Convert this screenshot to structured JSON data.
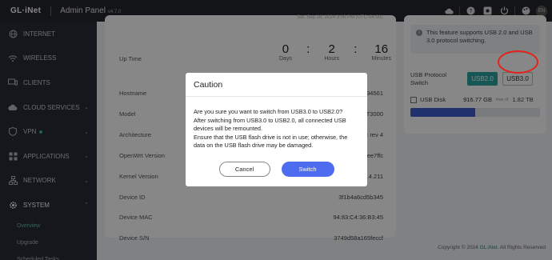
{
  "header": {
    "logo": "GL·iNet",
    "title": "Admin Panel",
    "version": "v4.7.0",
    "lang": "EN"
  },
  "sidebar": {
    "items": [
      {
        "label": "INTERNET",
        "icon": "globe-icon"
      },
      {
        "label": "WIRELESS",
        "icon": "wifi-icon"
      },
      {
        "label": "CLIENTS",
        "icon": "clients-icon"
      },
      {
        "label": "CLOUD SERVICES",
        "icon": "cloud-icon"
      },
      {
        "label": "VPN",
        "icon": "shield-icon"
      },
      {
        "label": "APPLICATIONS",
        "icon": "apps-icon"
      },
      {
        "label": "NETWORK",
        "icon": "network-icon"
      },
      {
        "label": "SYSTEM",
        "icon": "gear-icon"
      }
    ],
    "sub_items": [
      "Overview",
      "Upgrade",
      "Scheduled Tasks"
    ]
  },
  "system_info": {
    "datestamp": "Sat, Sep 28, 2024 3:06 PM (UTC-04:00)",
    "uptime_label": "Up Time",
    "uptime": {
      "days": "0",
      "hours": "2",
      "minutes": "16",
      "days_label": "Days",
      "hours_label": "Hours",
      "minutes_label": "Minutes"
    },
    "rows": [
      {
        "label": "Hostname",
        "value": "7227894561"
      },
      {
        "label": "Model",
        "value": "GL-MT3000"
      },
      {
        "label": "Architecture",
        "value": "MediaTek Filogic rev 4"
      },
      {
        "label": "OpenWrt Version",
        "value": "OpenWrt 21.02-SNAPSHOT r0-ee7ffc"
      },
      {
        "label": "Kernel Version",
        "value": "5.4.211"
      },
      {
        "label": "Device ID",
        "value": "3f1b4a6cd5b345"
      },
      {
        "label": "Device MAC",
        "value": "94:83:C4:36:B3:45"
      },
      {
        "label": "Device S/N",
        "value": "3749d58a165feccf"
      }
    ]
  },
  "usb": {
    "info": "This feature supports USB 2.0 and USB 3.0 protocol switching.",
    "protocol_label_1": "USB Protocol",
    "protocol_label_2": "Switch",
    "usb2_label": "USB2.0",
    "usb3_label": "USB3.0",
    "disk_label": "USB Disk",
    "disk_free": "916.77 GB",
    "disk_of": "free of",
    "disk_total": "1.82 TB",
    "disk_used_fraction": 0.5
  },
  "footer": {
    "copyright_prefix": "Copyright © 2024",
    "brand": "GL.iNet",
    "suffix": ". All Rights Reserved"
  },
  "modal": {
    "title": "Caution",
    "lines": [
      "Are you sure you want to switch from USB3.0 to USB2.0?",
      "After switching from USB3.0 to USB2.0, all connected USB devices will be remounted.",
      "Ensure that the USB flash drive is not in use; otherwise, the data on the USB flash drive may be damaged."
    ],
    "cancel_label": "Cancel",
    "switch_label": "Switch"
  }
}
